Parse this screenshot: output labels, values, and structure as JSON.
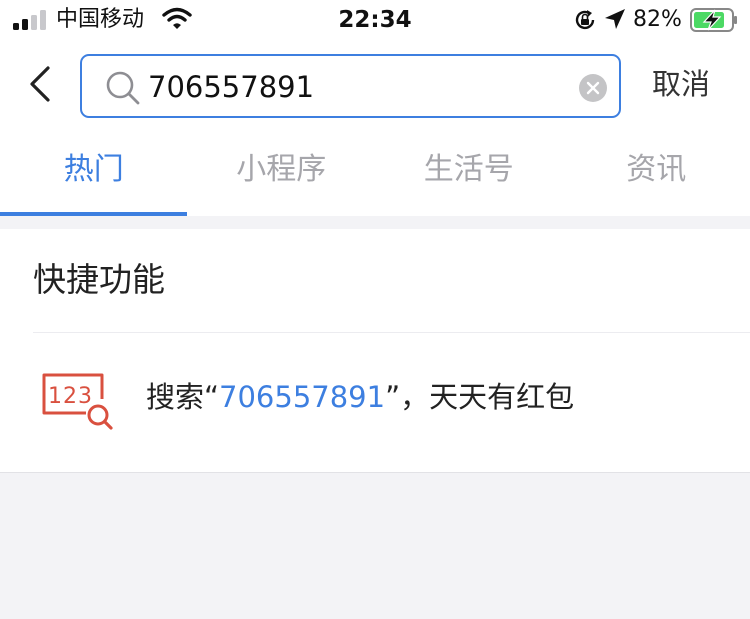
{
  "status_bar": {
    "carrier": "中国移动",
    "time": "22:34",
    "battery_percent": "82%",
    "icons": [
      "signal-icon",
      "wifi-icon",
      "orientation-lock-icon",
      "location-icon",
      "battery-charging-icon"
    ]
  },
  "search": {
    "query": "706557891",
    "cancel_label": "取消",
    "accent_color": "#3d7fe0"
  },
  "tabs": [
    {
      "label": "热门",
      "active": true
    },
    {
      "label": "小程序",
      "active": false
    },
    {
      "label": "生活号",
      "active": false
    },
    {
      "label": "资讯",
      "active": false
    }
  ],
  "quick_functions": {
    "title": "快捷功能",
    "item": {
      "icon": "number-search-icon",
      "icon_text": "123",
      "prefix": "搜索“",
      "keyword": "706557891",
      "suffix": "”，天天有红包"
    }
  }
}
